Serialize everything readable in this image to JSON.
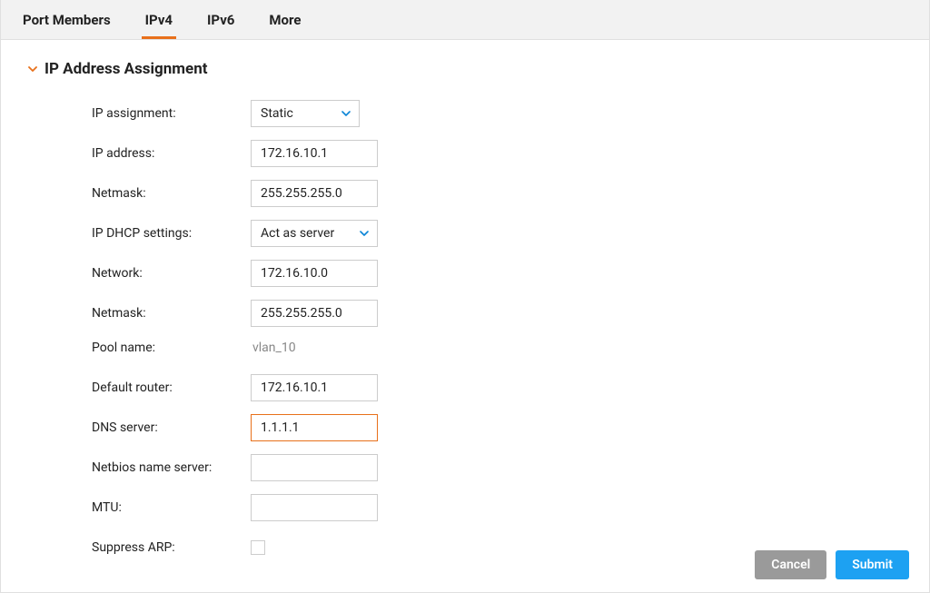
{
  "tabs": {
    "port_members": "Port Members",
    "ipv4": "IPv4",
    "ipv6": "IPv6",
    "more": "More"
  },
  "section": {
    "title": "IP Address Assignment"
  },
  "form": {
    "ip_assignment": {
      "label": "IP assignment:",
      "value": "Static"
    },
    "ip_address": {
      "label": "IP address:",
      "value": "172.16.10.1"
    },
    "netmask1": {
      "label": "Netmask:",
      "value": "255.255.255.0"
    },
    "dhcp": {
      "label": "IP DHCP settings:",
      "value": "Act as server"
    },
    "network": {
      "label": "Network:",
      "value": "172.16.10.0"
    },
    "netmask2": {
      "label": "Netmask:",
      "value": "255.255.255.0"
    },
    "pool_name": {
      "label": "Pool name:",
      "value": "vlan_10"
    },
    "default_router": {
      "label": "Default router:",
      "value": "172.16.10.1"
    },
    "dns_server": {
      "label": "DNS server:",
      "value": "1.1.1.1"
    },
    "netbios": {
      "label": "Netbios name server:",
      "value": ""
    },
    "mtu": {
      "label": "MTU:",
      "value": ""
    },
    "suppress_arp": {
      "label": "Suppress ARP:",
      "checked": false
    }
  },
  "footer": {
    "cancel": "Cancel",
    "submit": "Submit"
  }
}
